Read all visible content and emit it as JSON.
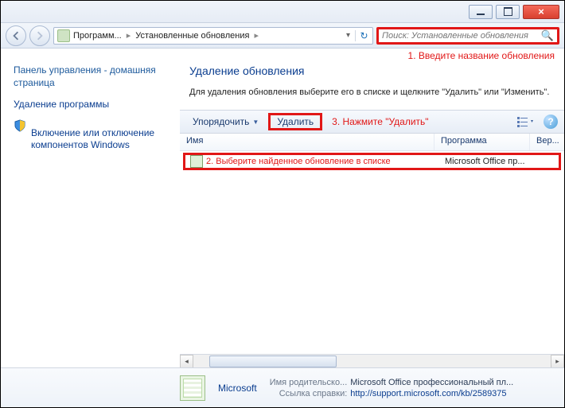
{
  "window": {
    "min_label": "–",
    "close_label": "×"
  },
  "address": {
    "crumb1": "Программ...",
    "crumb2": "Установленные обновления",
    "search_placeholder": "Поиск: Установленные обновления"
  },
  "annotations": {
    "a1": "1. Введите название обновления",
    "a2": "2. Выберите найденное обновление в списке",
    "a3": "3. Нажмите \"Удалить\""
  },
  "sidebar": {
    "home": "Панель управления - домашняя страница",
    "link1": "Удаление программы",
    "link2": "Включение или отключение компонентов Windows"
  },
  "main": {
    "title": "Удаление обновления",
    "desc": "Для удаления обновления выберите его в списке и щелкните \"Удалить\" или \"Изменить\"."
  },
  "toolbar": {
    "organize": "Упорядочить",
    "delete": "Удалить"
  },
  "columns": {
    "name": "Имя",
    "program": "Программа",
    "version": "Вер..."
  },
  "list": {
    "item_program": "Microsoft Office пр..."
  },
  "details": {
    "vendor": "Microsoft",
    "parent_label": "Имя родительско...",
    "parent_value": "Microsoft Office профессиональный пл...",
    "help_label": "Ссылка справки:",
    "help_value": "http://support.microsoft.com/kb/2589375"
  }
}
